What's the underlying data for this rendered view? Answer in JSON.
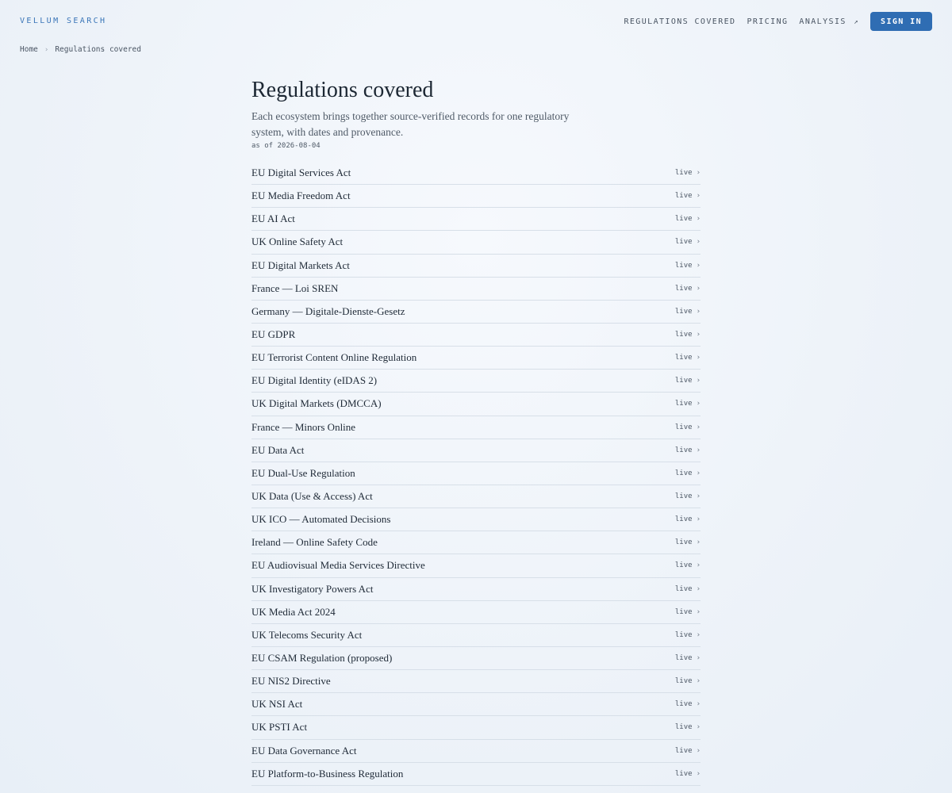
{
  "brand": "VELLUM SEARCH",
  "nav": {
    "regulations": "REGULATIONS COVERED",
    "pricing": "PRICING",
    "analysis": "ANALYSIS",
    "analysis_icon": "↗",
    "sign_in": "SIGN IN"
  },
  "breadcrumb": {
    "home": "Home",
    "separator": "›",
    "current": "Regulations covered"
  },
  "page": {
    "title": "Regulations covered",
    "subtitle": "Each ecosystem brings together source-verified records for one regulatory system, with dates and provenance.",
    "as_of": "as of 2026-08-04"
  },
  "row_chevron": "›",
  "regulations": [
    {
      "name": "EU Digital Services Act",
      "status": "live"
    },
    {
      "name": "EU Media Freedom Act",
      "status": "live"
    },
    {
      "name": "EU AI Act",
      "status": "live"
    },
    {
      "name": "UK Online Safety Act",
      "status": "live"
    },
    {
      "name": "EU Digital Markets Act",
      "status": "live"
    },
    {
      "name": "France — Loi SREN",
      "status": "live"
    },
    {
      "name": "Germany — Digitale-Dienste-Gesetz",
      "status": "live"
    },
    {
      "name": "EU GDPR",
      "status": "live"
    },
    {
      "name": "EU Terrorist Content Online Regulation",
      "status": "live"
    },
    {
      "name": "EU Digital Identity (eIDAS 2)",
      "status": "live"
    },
    {
      "name": "UK Digital Markets (DMCCA)",
      "status": "live"
    },
    {
      "name": "France — Minors Online",
      "status": "live"
    },
    {
      "name": "EU Data Act",
      "status": "live"
    },
    {
      "name": "EU Dual-Use Regulation",
      "status": "live"
    },
    {
      "name": "UK Data (Use & Access) Act",
      "status": "live"
    },
    {
      "name": "UK ICO — Automated Decisions",
      "status": "live"
    },
    {
      "name": "Ireland — Online Safety Code",
      "status": "live"
    },
    {
      "name": "EU Audiovisual Media Services Directive",
      "status": "live"
    },
    {
      "name": "UK Investigatory Powers Act",
      "status": "live"
    },
    {
      "name": "UK Media Act 2024",
      "status": "live"
    },
    {
      "name": "UK Telecoms Security Act",
      "status": "live"
    },
    {
      "name": "EU CSAM Regulation (proposed)",
      "status": "live"
    },
    {
      "name": "EU NIS2 Directive",
      "status": "live"
    },
    {
      "name": "UK NSI Act",
      "status": "live"
    },
    {
      "name": "UK PSTI Act",
      "status": "live"
    },
    {
      "name": "EU Data Governance Act",
      "status": "live"
    },
    {
      "name": "EU Platform-to-Business Regulation",
      "status": "live"
    }
  ]
}
